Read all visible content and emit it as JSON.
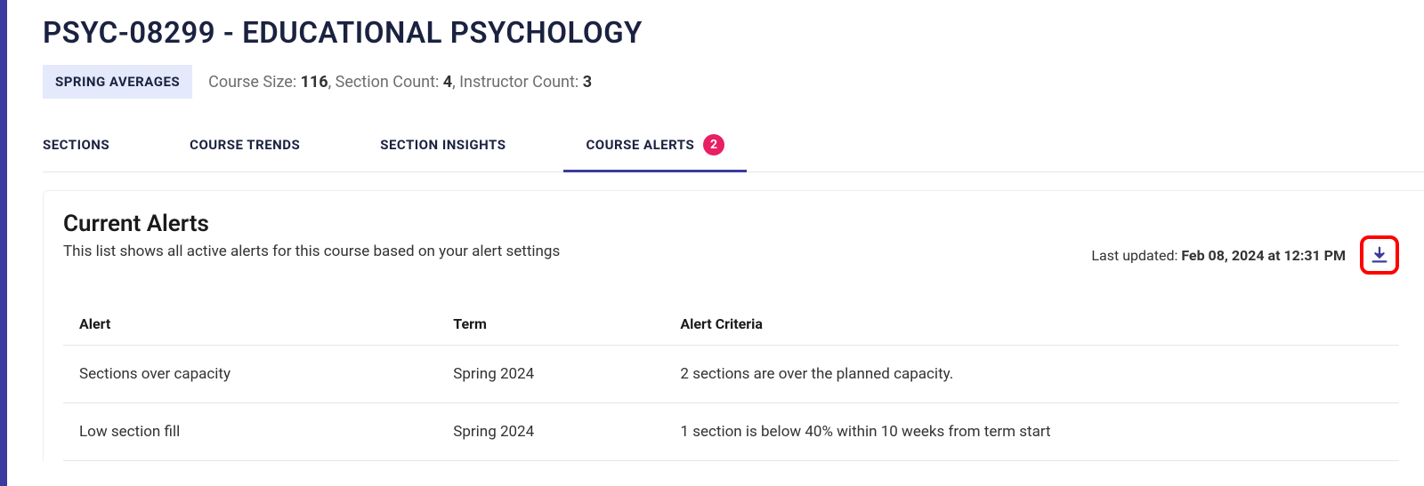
{
  "header": {
    "course_title": "PSYC-08299 - EDUCATIONAL PSYCHOLOGY",
    "badge_label": "SPRING AVERAGES",
    "course_size_label": "Course Size: ",
    "course_size_value": "116",
    "section_count_label": ", Section Count: ",
    "section_count_value": "4",
    "instructor_count_label": ", Instructor Count: ",
    "instructor_count_value": "3"
  },
  "tabs": {
    "sections": "SECTIONS",
    "course_trends": "COURSE TRENDS",
    "section_insights": "SECTION INSIGHTS",
    "course_alerts": "COURSE ALERTS",
    "alerts_badge": "2"
  },
  "panel": {
    "title": "Current Alerts",
    "description": "This list shows all active alerts for this course based on your alert settings",
    "last_updated_label": "Last updated: ",
    "last_updated_value": "Feb 08, 2024 at 12:31 PM"
  },
  "table": {
    "headers": {
      "alert": "Alert",
      "term": "Term",
      "criteria": "Alert Criteria"
    },
    "rows": [
      {
        "alert": "Sections over capacity",
        "term": "Spring 2024",
        "criteria": "2 sections are over the planned capacity."
      },
      {
        "alert": "Low section fill",
        "term": "Spring 2024",
        "criteria": "1 section is below 40% within 10 weeks from term start"
      }
    ]
  },
  "colors": {
    "accent": "#3b3b9e",
    "badge_bg": "#e91e63",
    "highlight_border": "#ff0000"
  }
}
